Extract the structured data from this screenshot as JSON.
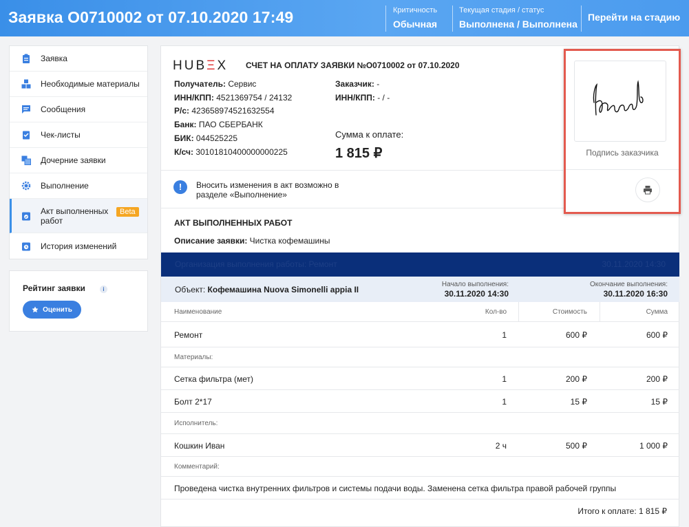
{
  "header": {
    "title": "Заявка О0710002 от 07.10.2020 17:49",
    "criticality_caption": "Критичность",
    "criticality_value": "Обычная",
    "stage_caption": "Текущая стадия / статус",
    "stage_value": "Выполнена / Выполнена",
    "goto_label": "Перейти на стадию"
  },
  "sidebar": {
    "items": [
      {
        "label": "Заявка",
        "icon": "clipboard-icon"
      },
      {
        "label": "Необходимые материалы",
        "icon": "boxes-icon"
      },
      {
        "label": "Сообщения",
        "icon": "chat-icon"
      },
      {
        "label": "Чек-листы",
        "icon": "checklist-icon"
      },
      {
        "label": "Дочерние заявки",
        "icon": "copy-icon"
      },
      {
        "label": "Выполнение",
        "icon": "gear-icon"
      },
      {
        "label": "Акт выполненных работ",
        "icon": "act-icon",
        "badge": "Beta"
      },
      {
        "label": "История изменений",
        "icon": "history-icon"
      }
    ]
  },
  "rating": {
    "title": "Рейтинг заявки",
    "info": "i",
    "button": "Оценить"
  },
  "invoice": {
    "logo_a": "HUB",
    "logo_b": "Ξ",
    "logo_c": "X",
    "title": "СЧЕТ НА ОПЛАТУ ЗАЯВКИ №О0710002 от 07.10.2020",
    "recipient_label": "Получатель:",
    "recipient": "Сервис",
    "inn_label": "ИНН/КПП:",
    "inn": "4521369754 / 24132",
    "account_label": "Р/с:",
    "account": "42365897452163255­4",
    "bank_label": "Банк:",
    "bank": "ПАО СБЕРБАНК",
    "bik_label": "БИК:",
    "bik": "044525225",
    "ks_label": "К/сч:",
    "ks": "30101810400000000225",
    "customer_label": "Заказчик:",
    "customer": "-",
    "cust_inn_label": "ИНН/КПП:",
    "cust_inn": "- / -",
    "sum_caption": "Сумма к оплате:",
    "sum_value": "1 815 ₽"
  },
  "notice": {
    "icon": "!",
    "text": "Вносить изменения в акт возможно в разделе «Выполнение»"
  },
  "act": {
    "title": "АКТ ВЫПОЛНЕННЫХ РАБОТ",
    "desc_label": "Описание заявки:",
    "desc": "Чистка кофемашины",
    "bar_title": "Организация выполнения работы: Ремонт",
    "bar_date": "30.11.2020 14:30",
    "object_label": "Объект:",
    "object": "Кофемашина Nuova Simonelli appia II",
    "start_caption": "Начало выполнения:",
    "start_value": "30.11.2020 14:30",
    "end_caption": "Окончание выполнения:",
    "end_value": "30.11.2020 16:30"
  },
  "table": {
    "headers": {
      "name": "Наименование",
      "qty": "Кол-во",
      "cost": "Стоимость",
      "sum": "Сумма"
    },
    "work": {
      "name": "Ремонт",
      "qty": "1",
      "cost": "600 ₽",
      "sum": "600 ₽"
    },
    "materials_label": "Материалы:",
    "materials": [
      {
        "name": "Сетка фильтра (мет)",
        "qty": "1",
        "cost": "200 ₽",
        "sum": "200 ₽"
      },
      {
        "name": "Болт 2*17",
        "qty": "1",
        "cost": "15 ₽",
        "sum": "15 ₽"
      }
    ],
    "executor_label": "Исполнитель:",
    "executor": {
      "name": "Кошкин Иван",
      "qty": "2 ч",
      "cost": "500 ₽",
      "sum": "1 000 ₽"
    },
    "comment_label": "Комментарий:",
    "comment": "Проведена чистка внутренних фильтров и системы подачи воды. Заменена сетка фильтра правой рабочей группы",
    "total": "Итого к оплате: 1 815 ₽"
  },
  "signature": {
    "caption": "Подпись заказчика"
  }
}
